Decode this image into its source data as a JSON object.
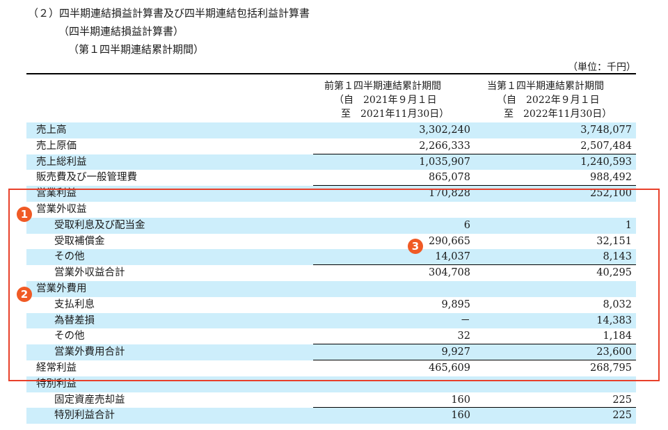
{
  "heading": {
    "line1": "（２）四半期連結損益計算書及び四半期連結包括利益計算書",
    "line2": "（四半期連結損益計算書）",
    "line3": "（第１四半期連結累計期間）",
    "unit": "（単位：千円）"
  },
  "columns": {
    "prev": {
      "title": "前第１四半期連結累計期間",
      "from": "（自　2021年９月１日",
      "to": "至　2021年11月30日）"
    },
    "curr": {
      "title": "当第１四半期連結累計期間",
      "from": "（自　2022年９月１日",
      "to": "至　2022年11月30日）"
    }
  },
  "rows": [
    {
      "label": "売上高",
      "prev": "3,302,240",
      "curr": "3,748,077"
    },
    {
      "label": "売上原価",
      "prev": "2,266,333",
      "curr": "2,507,484"
    },
    {
      "label": "売上総利益",
      "prev": "1,035,907",
      "curr": "1,240,593"
    },
    {
      "label": "販売費及び一般管理費",
      "prev": "865,078",
      "curr": "988,492"
    },
    {
      "label": "営業利益",
      "prev": "170,828",
      "curr": "252,100"
    },
    {
      "label": "営業外収益",
      "prev": "",
      "curr": ""
    },
    {
      "label": "受取利息及び配当金",
      "prev": "6",
      "curr": "1"
    },
    {
      "label": "受取補償金",
      "prev": "290,665",
      "curr": "32,151"
    },
    {
      "label": "その他",
      "prev": "14,037",
      "curr": "8,143"
    },
    {
      "label": "営業外収益合計",
      "prev": "304,708",
      "curr": "40,295"
    },
    {
      "label": "営業外費用",
      "prev": "",
      "curr": ""
    },
    {
      "label": "支払利息",
      "prev": "9,895",
      "curr": "8,032"
    },
    {
      "label": "為替差損",
      "prev": "－",
      "curr": "14,383"
    },
    {
      "label": "その他",
      "prev": "32",
      "curr": "1,184"
    },
    {
      "label": "営業外費用合計",
      "prev": "9,927",
      "curr": "23,600"
    },
    {
      "label": "経常利益",
      "prev": "465,609",
      "curr": "268,795"
    },
    {
      "label": "特別利益",
      "prev": "",
      "curr": ""
    },
    {
      "label": "固定資産売却益",
      "prev": "160",
      "curr": "225"
    },
    {
      "label": "特別利益合計",
      "prev": "160",
      "curr": "225"
    }
  ],
  "badges": {
    "b1": "1",
    "b2": "2",
    "b3": "3"
  },
  "colors": {
    "shade": "#cdeefb",
    "highlight": "#e8402a",
    "badge": "#f05a25"
  }
}
